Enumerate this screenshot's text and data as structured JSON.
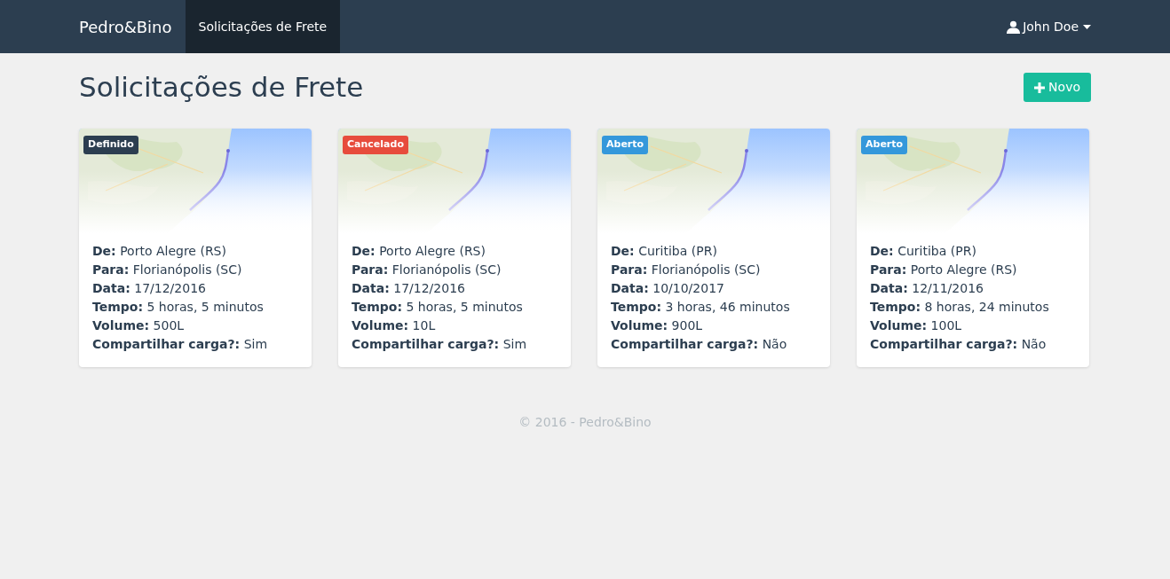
{
  "navbar": {
    "brand": "Pedro&Bino",
    "links": [
      {
        "label": "Solicitações de Frete",
        "selected": true
      }
    ],
    "user": {
      "label": "John Doe"
    }
  },
  "page": {
    "title": "Solicitações de Frete",
    "new_button": "Novo"
  },
  "cards": [
    {
      "status": "Definido",
      "color": "#2c3e50",
      "fields": [
        {
          "label": "De:",
          "value": "Porto Alegre (RS)"
        },
        {
          "label": "Para:",
          "value": "Florianópolis (SC)"
        },
        {
          "label": "Data:",
          "value": "17/12/2016"
        },
        {
          "label": "Tempo:",
          "value": "5 horas, 5 minutos"
        },
        {
          "label": "Volume:",
          "value": "500L"
        },
        {
          "label": "Compartilhar carga?:",
          "value": "Sim"
        }
      ]
    },
    {
      "status": "Cancelado",
      "color": "#e74c3c",
      "fields": [
        {
          "label": "De:",
          "value": "Porto Alegre (RS)"
        },
        {
          "label": "Para:",
          "value": "Florianópolis (SC)"
        },
        {
          "label": "Data:",
          "value": "17/12/2016"
        },
        {
          "label": "Tempo:",
          "value": "5 horas, 5 minutos"
        },
        {
          "label": "Volume:",
          "value": "10L"
        },
        {
          "label": "Compartilhar carga?:",
          "value": "Sim"
        }
      ]
    },
    {
      "status": "Aberto",
      "color": "#3498db",
      "fields": [
        {
          "label": "De:",
          "value": "Curitiba (PR)"
        },
        {
          "label": "Para:",
          "value": "Florianópolis (SC)"
        },
        {
          "label": "Data:",
          "value": "10/10/2017"
        },
        {
          "label": "Tempo:",
          "value": "3 horas, 46 minutos"
        },
        {
          "label": "Volume:",
          "value": "900L"
        },
        {
          "label": "Compartilhar carga?:",
          "value": "Não"
        }
      ]
    },
    {
      "status": "Aberto",
      "color": "#3498db",
      "fields": [
        {
          "label": "De:",
          "value": "Curitiba (PR)"
        },
        {
          "label": "Para:",
          "value": "Porto Alegre (RS)"
        },
        {
          "label": "Data:",
          "value": "12/11/2016"
        },
        {
          "label": "Tempo:",
          "value": "8 horas, 24 minutos"
        },
        {
          "label": "Volume:",
          "value": "100L"
        },
        {
          "label": "Compartilhar carga?:",
          "value": "Não"
        }
      ]
    }
  ],
  "footer": "© 2016 - Pedro&Bino"
}
